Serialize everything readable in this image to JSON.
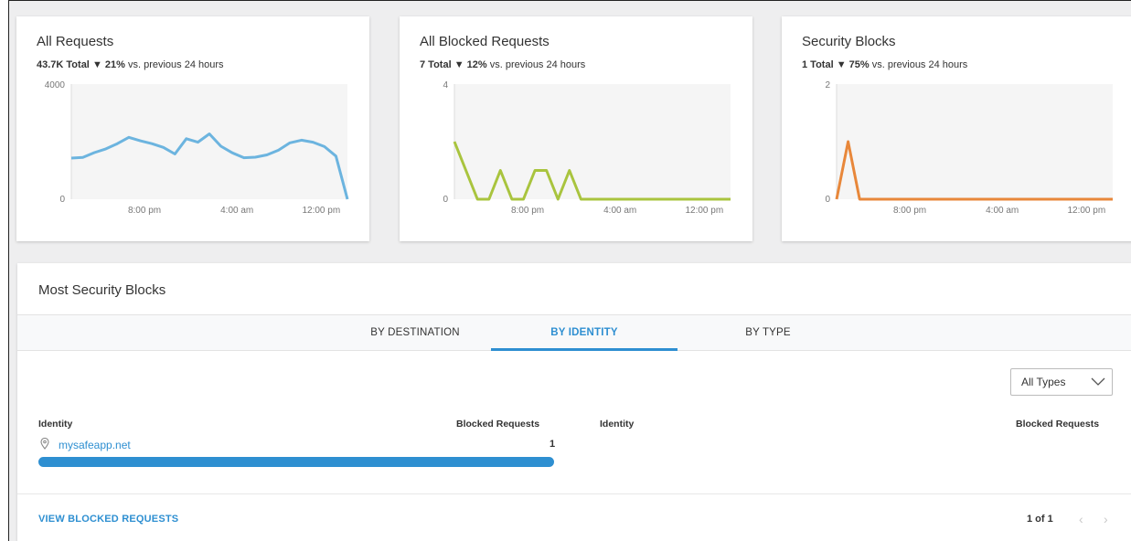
{
  "cards": [
    {
      "title": "All Requests",
      "total": "43.7K Total",
      "arrow": "▼",
      "pct": "21%",
      "suffix": " vs. previous 24 hours",
      "color": "#6cb4df",
      "y_max_label": "4000",
      "y_min_label": "0",
      "x_ticks": [
        "8:00 pm",
        "4:00 am",
        "12:00 pm"
      ],
      "chart_data": {
        "type": "line",
        "ylim": [
          0,
          4000
        ],
        "y": [
          1430,
          1450,
          1620,
          1750,
          1930,
          2150,
          2030,
          1930,
          1800,
          1570,
          2100,
          1980,
          2270,
          1840,
          1610,
          1440,
          1460,
          1540,
          1700,
          1960,
          2050,
          1980,
          1830,
          1500,
          0
        ]
      }
    },
    {
      "title": "All Blocked Requests",
      "total": "7 Total",
      "arrow": "▼",
      "pct": "12%",
      "suffix": " vs. previous 24 hours",
      "color": "#a9c43e",
      "y_max_label": "4",
      "y_min_label": "0",
      "x_ticks": [
        "8:00 pm",
        "4:00 am",
        "12:00 pm"
      ],
      "chart_data": {
        "type": "line",
        "ylim": [
          0,
          4
        ],
        "y": [
          2,
          1,
          0,
          0,
          1,
          0,
          0,
          1,
          1,
          0,
          1,
          0,
          0,
          0,
          0,
          0,
          0,
          0,
          0,
          0,
          0,
          0,
          0,
          0,
          0
        ]
      }
    },
    {
      "title": "Security Blocks",
      "total": "1 Total",
      "arrow": "▼",
      "pct": "75%",
      "suffix": " vs. previous 24 hours",
      "color": "#e8873a",
      "y_max_label": "2",
      "y_min_label": "0",
      "x_ticks": [
        "8:00 pm",
        "4:00 am",
        "12:00 pm"
      ],
      "chart_data": {
        "type": "line",
        "ylim": [
          0,
          2
        ],
        "y": [
          0,
          1,
          0,
          0,
          0,
          0,
          0,
          0,
          0,
          0,
          0,
          0,
          0,
          0,
          0,
          0,
          0,
          0,
          0,
          0,
          0,
          0,
          0,
          0,
          0
        ]
      }
    }
  ],
  "panel": {
    "title": "Most Security Blocks",
    "tabs": [
      "BY DESTINATION",
      "BY IDENTITY",
      "BY TYPE"
    ],
    "active_tab": "BY IDENTITY",
    "filter_value": "All Types",
    "columns": [
      "Identity",
      "Blocked Requests",
      "Identity",
      "Blocked Requests"
    ],
    "rows": [
      {
        "identity": "mysafeapp.net",
        "blocked": "1",
        "share": 1.0,
        "icon": "location-pin-icon"
      }
    ],
    "footer_link": "VIEW BLOCKED REQUESTS",
    "pager_text": "1 of 1",
    "prev_icon": "chevron-left-icon",
    "next_icon": "chevron-right-icon",
    "accent": "#2e8fd1"
  }
}
